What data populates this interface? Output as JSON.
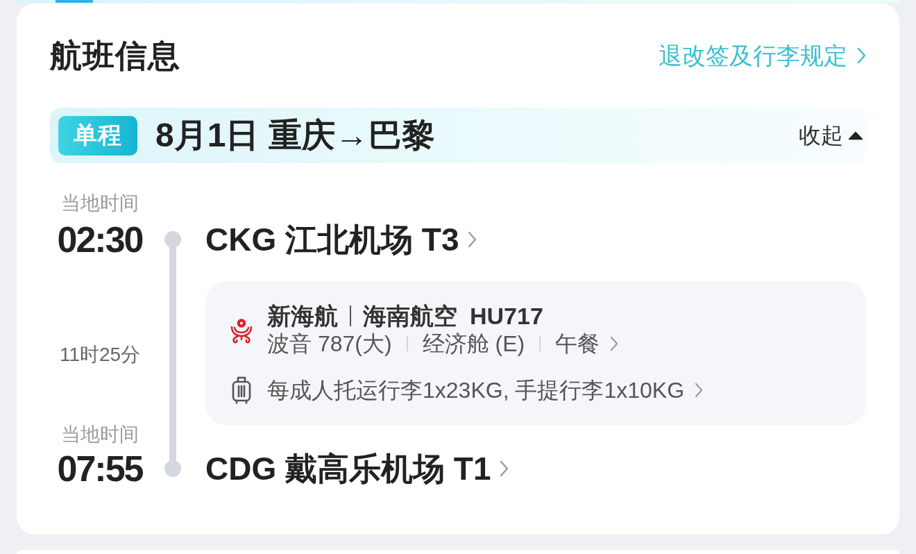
{
  "section": {
    "title": "航班信息",
    "link": "退改签及行李规定"
  },
  "trip": {
    "badge": "单程",
    "summary": "8月1日 重庆→巴黎",
    "toggle": "收起",
    "expanded": true
  },
  "departure": {
    "label": "当地时间",
    "time": "02:30",
    "airport": "CKG 江北机场 T3"
  },
  "duration": "11时25分",
  "segment": {
    "brand": "新海航",
    "airline": "海南航空",
    "flight_no": "HU717",
    "details": [
      "波音 787(大)",
      "经济舱 (E)",
      "午餐"
    ],
    "baggage": "每成人托运行李1x23KG, 手提行李1x10KG"
  },
  "arrival": {
    "label": "当地时间",
    "time": "07:55",
    "airport": "CDG 戴高乐机场 T1"
  }
}
